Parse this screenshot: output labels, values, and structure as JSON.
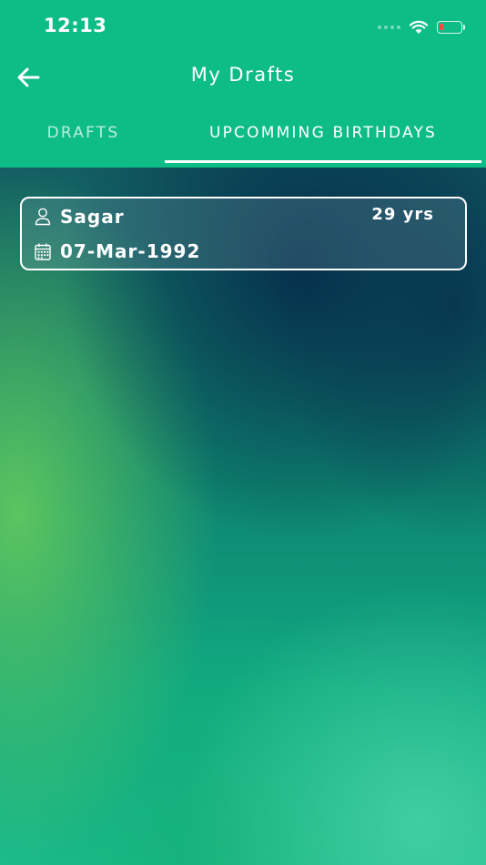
{
  "status_bar": {
    "time": "12:13"
  },
  "nav": {
    "title": "My Drafts",
    "back_icon": "arrow-left-icon"
  },
  "tabs": [
    {
      "label": "DRAFTS",
      "active": false
    },
    {
      "label": "UPCOMMING BIRTHDAYS",
      "active": true
    }
  ],
  "birthdays": [
    {
      "name": "Sagar",
      "date": "07-Mar-1992",
      "age": "29 yrs",
      "name_icon": "person-icon",
      "date_icon": "calendar-icon"
    }
  ],
  "colors": {
    "header": "#0ebd86",
    "accent": "#ffffff",
    "battery_low": "#ff4b3e"
  }
}
